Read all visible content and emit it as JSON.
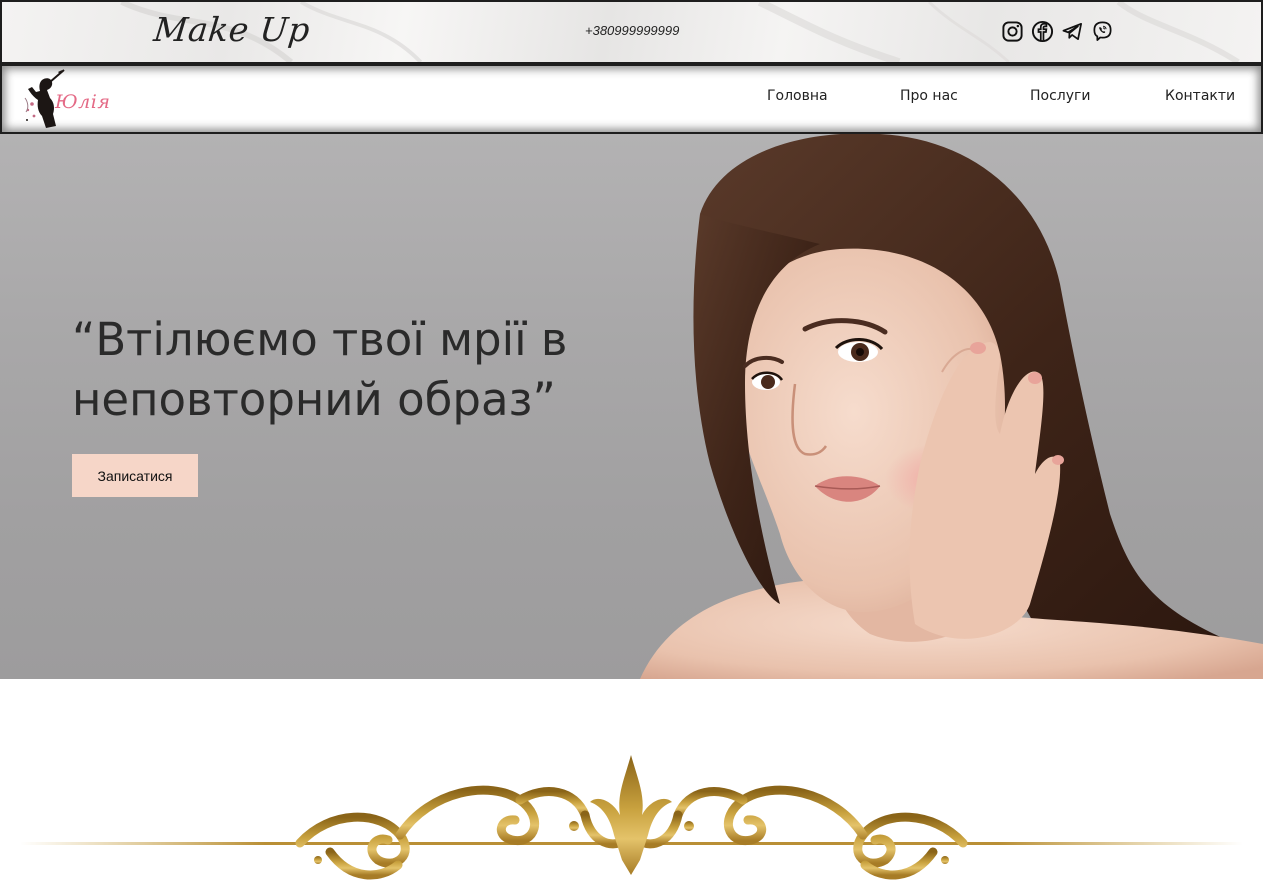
{
  "topbar": {
    "brand": "Make Up",
    "phone": "+380999999999",
    "socials": [
      {
        "name": "instagram-icon"
      },
      {
        "name": "facebook-icon"
      },
      {
        "name": "telegram-icon"
      },
      {
        "name": "viber-icon"
      }
    ]
  },
  "nav": {
    "logo_text": "Юлія",
    "items": [
      {
        "label": "Головна"
      },
      {
        "label": "Про нас"
      },
      {
        "label": "Послуги"
      },
      {
        "label": "Контакти"
      }
    ]
  },
  "hero": {
    "headline_line1": "“Втілюємо твої мрії в",
    "headline_line2": "неповторний образ”",
    "cta_label": "Записатися"
  },
  "colors": {
    "cta_background": "#f6d6c8",
    "logo_pink": "#e46a86",
    "ornament_gold": "#c9a23f"
  }
}
